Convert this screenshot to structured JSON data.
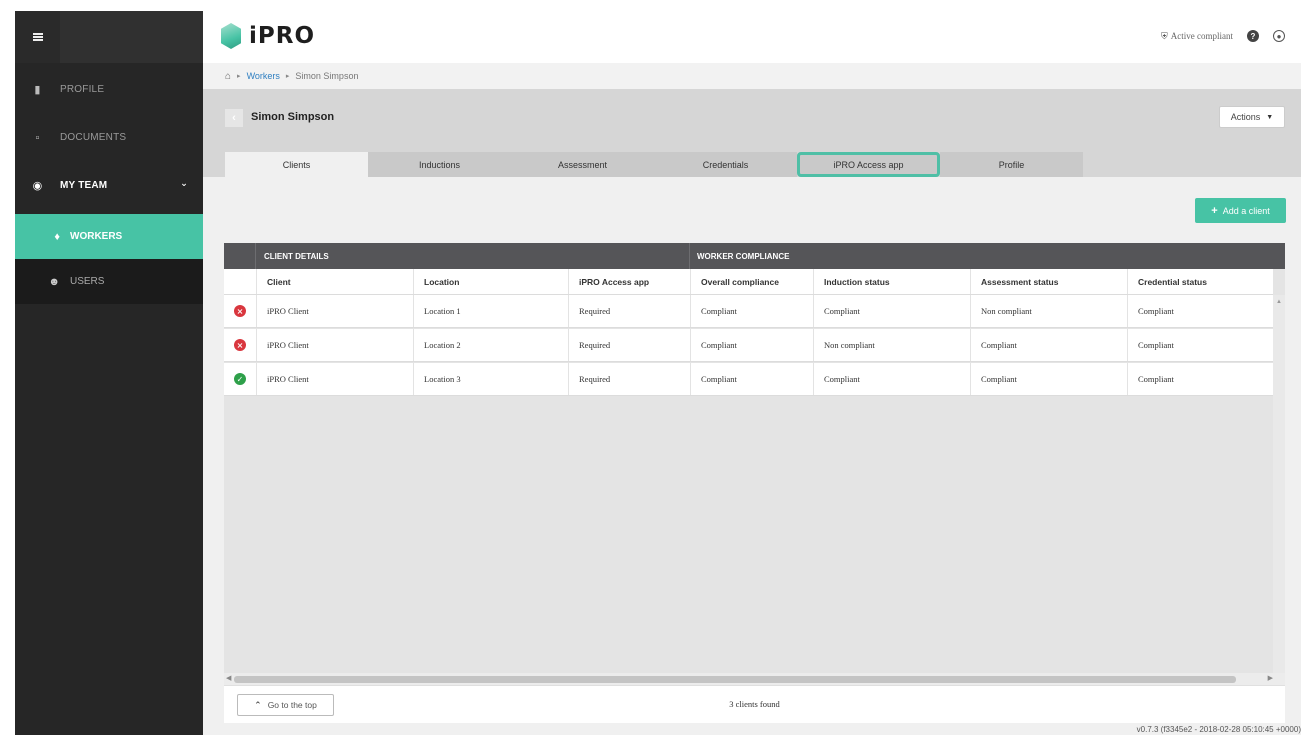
{
  "sidebar": {
    "items": [
      {
        "label": "PROFILE",
        "icon": "profile-icon"
      },
      {
        "label": "DOCUMENTS",
        "icon": "document-icon"
      },
      {
        "label": "MY TEAM",
        "icon": "team-icon"
      },
      {
        "label": "WORKERS",
        "icon": "worker-icon"
      },
      {
        "label": "USERS",
        "icon": "users-icon"
      }
    ]
  },
  "header": {
    "logo_text": "iPRO",
    "status_label": "Active compliant"
  },
  "breadcrumb": {
    "items": [
      "Workers",
      "Simon Simpson"
    ]
  },
  "page": {
    "title": "Simon Simpson",
    "actions_label": "Actions"
  },
  "tabs": [
    {
      "label": "Clients",
      "active": true
    },
    {
      "label": "Inductions"
    },
    {
      "label": "Assessment"
    },
    {
      "label": "Credentials"
    },
    {
      "label": "iPRO Access app",
      "highlighted": true
    },
    {
      "label": "Profile"
    }
  ],
  "add_client_label": "Add a client",
  "table": {
    "groups": [
      "CLIENT DETAILS",
      "WORKER COMPLIANCE"
    ],
    "columns": [
      "Client",
      "Location",
      "iPRO Access app",
      "Overall compliance",
      "Induction status",
      "Assessment status",
      "Credential status"
    ],
    "rows": [
      {
        "status": "error",
        "cells": [
          "iPRO Client",
          "Location 1",
          "Required",
          "Compliant",
          "Compliant",
          "Non compliant",
          "Compliant"
        ]
      },
      {
        "status": "error",
        "cells": [
          "iPRO Client",
          "Location 2",
          "Required",
          "Compliant",
          "Non compliant",
          "Compliant",
          "Compliant"
        ]
      },
      {
        "status": "ok",
        "cells": [
          "iPRO Client",
          "Location 3",
          "Required",
          "Compliant",
          "Compliant",
          "Compliant",
          "Compliant"
        ]
      }
    ]
  },
  "footer": {
    "goto_top_label": "Go to the top",
    "count_text": "3 clients found"
  },
  "version": "v0.7.3 (f3345e2 - 2018-02-28 05:10:45 +0000)",
  "colors": {
    "accent": "#47c3a5",
    "sidebar": "#262626",
    "error": "#d9363e",
    "ok": "#2ea04a"
  }
}
